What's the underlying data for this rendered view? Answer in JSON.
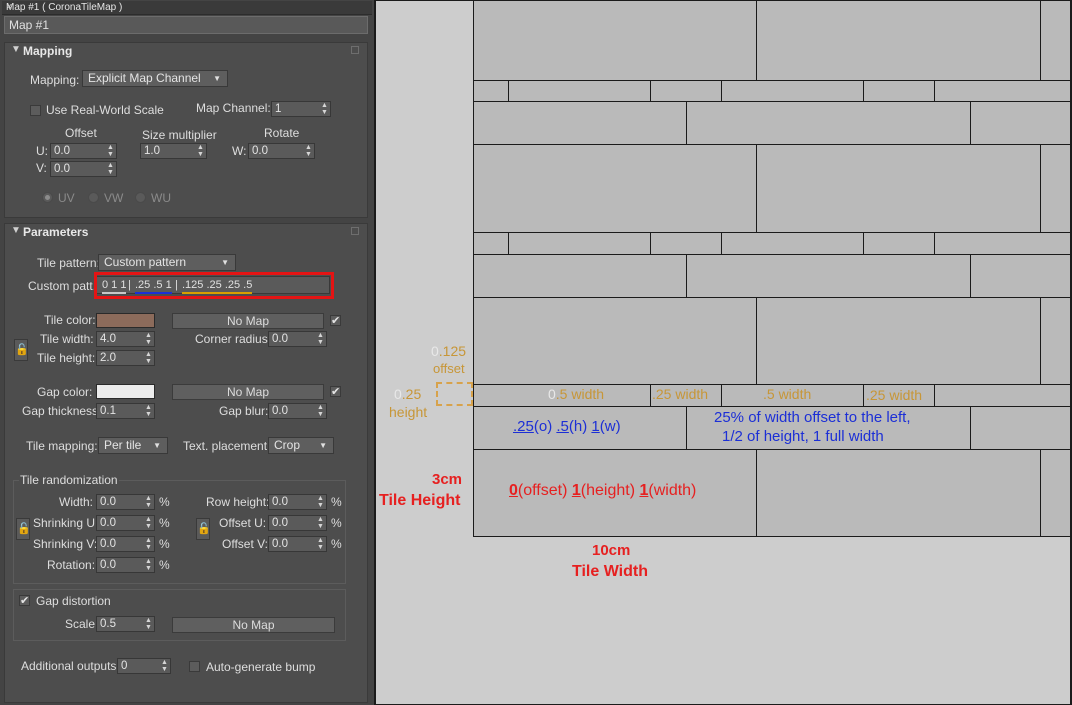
{
  "window": {
    "title": "Map #1  ( CoronaTileMap )",
    "close": "×"
  },
  "map_name": "Map #1",
  "mapping": {
    "rollout_title": "Mapping",
    "mapping_label": "Mapping:",
    "mapping_value": "Explicit Map Channel",
    "use_real_world_label": "Use Real-World Scale",
    "map_channel_label": "Map Channel:",
    "map_channel_value": "1",
    "offset_header": "Offset",
    "size_header": "Size multiplier",
    "rotate_header": "Rotate",
    "u_label": "U:",
    "u_value": "0.0",
    "v_label": "V:",
    "v_value": "0.0",
    "size_value": "1.0",
    "w_label": "W:",
    "w_value": "0.0",
    "uv": "UV",
    "vw": "VW",
    "wu": "WU"
  },
  "parameters": {
    "rollout_title": "Parameters",
    "tile_pattern_label": "Tile pattern:",
    "tile_pattern_value": "Custom pattern",
    "custom_patt_label": "Custom patt.:",
    "custom_seg1": "0 1 1",
    "custom_seg2": ".25 .5 1",
    "custom_seg3": ".125 .25 .25 .5",
    "sep": "|",
    "tile_color_label": "Tile color:",
    "tile_color": "#8c6b5b",
    "no_map": "No Map",
    "tile_width_label": "Tile width:",
    "tile_width_value": "4.0",
    "tile_height_label": "Tile height:",
    "tile_height_value": "2.0",
    "corner_radius_label": "Corner radius:",
    "corner_radius_value": "0.0",
    "gap_color_label": "Gap color:",
    "gap_color": "#ececec",
    "gap_thickness_label": "Gap thickness:",
    "gap_thickness_value": "0.1",
    "gap_blur_label": "Gap blur:",
    "gap_blur_value": "0.0",
    "tile_mapping_label": "Tile mapping:",
    "tile_mapping_value": "Per tile",
    "text_placement_label": "Text. placement:",
    "text_placement_value": "Crop",
    "randomization_title": "Tile randomization",
    "width_label": "Width:",
    "width_value": "0.0",
    "row_height_label": "Row height:",
    "row_height_value": "0.0",
    "shrinking_u_label": "Shrinking U:",
    "shrinking_u_value": "0.0",
    "offset_u_label": "Offset U:",
    "offset_u_value": "0.0",
    "shrinking_v_label": "Shrinking V:",
    "shrinking_v_value": "0.0",
    "offset_v_label": "Offset V:",
    "offset_v_value": "0.0",
    "rotation_label": "Rotation:",
    "rotation_value": "0.0",
    "percent": "%",
    "gap_distortion_label": "Gap distortion",
    "scale_label": "Scale:",
    "scale_value": "0.5",
    "additional_outputs_label": "Additional outputs:",
    "additional_outputs_value": "0",
    "auto_bump_label": "Auto-generate bump",
    "check_mark": "✔"
  },
  "annotations": {
    "offset_num_pre": "0",
    "offset_num": ".125",
    "offset_word": "offset",
    "height_num_pre": "0",
    "height_num": ".25",
    "height_word": "height",
    "w1_pre": "0",
    "w1": ".5 width",
    "w2": ".25 width",
    "w3": ".5 width",
    "w4": ".25 width",
    "row2_o": ".25",
    "row2_o_t": "(o)",
    "row2_h": ".5",
    "row2_h_t": "(h)",
    "row2_w": "1",
    "row2_w_t": "(w)",
    "row2_desc1": "25% of width offset to the left,",
    "row2_desc2": "1/2 of height, 1 full width",
    "row1_o": "0",
    "row1_o_t": "(offset)",
    "row1_h": "1",
    "row1_h_t": "(height)",
    "row1_w": "1",
    "row1_w_t": "(width)",
    "h_size": "3cm",
    "h_label": "Tile Height",
    "w_size": "10cm",
    "w_label": "Tile Width"
  },
  "colors": {
    "underline_gray": "#c8c8c8",
    "underline_blue": "#1c2fd6",
    "underline_orange": "#d8a000",
    "annotation_red": "#e62020"
  }
}
